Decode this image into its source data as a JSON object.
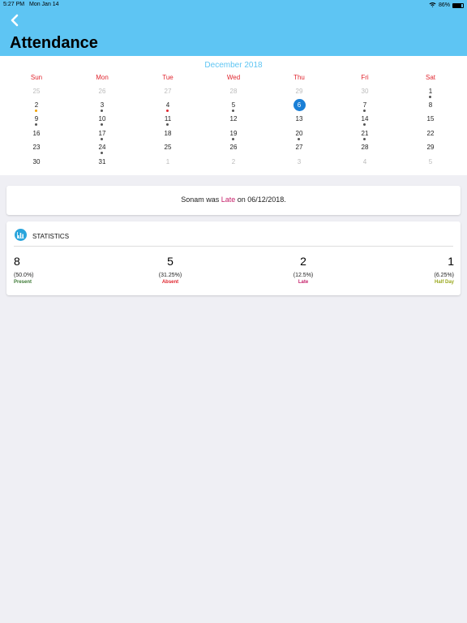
{
  "status_bar": {
    "time": "5:27 PM",
    "date": "Mon Jan 14",
    "battery": "86%",
    "battery_level": 0.86
  },
  "header": {
    "title": "Attendance"
  },
  "calendar": {
    "month": "December 2018",
    "weekdays": [
      "Sun",
      "Mon",
      "Tue",
      "Wed",
      "Thu",
      "Fri",
      "Sat"
    ],
    "weeks": [
      [
        {
          "d": "25",
          "m": true
        },
        {
          "d": "26",
          "m": true
        },
        {
          "d": "27",
          "m": true
        },
        {
          "d": "28",
          "m": true
        },
        {
          "d": "29",
          "m": true
        },
        {
          "d": "30",
          "m": true
        },
        {
          "d": "1",
          "dot": "gray"
        }
      ],
      [
        {
          "d": "2",
          "dot": "orange"
        },
        {
          "d": "3",
          "dot": "gray"
        },
        {
          "d": "4",
          "dot": "red"
        },
        {
          "d": "5",
          "dot": "gray"
        },
        {
          "d": "6",
          "selected": true
        },
        {
          "d": "7",
          "dot": "gray"
        },
        {
          "d": "8"
        }
      ],
      [
        {
          "d": "9",
          "dot": "gray"
        },
        {
          "d": "10",
          "dot": "gray"
        },
        {
          "d": "11",
          "dot": "gray"
        },
        {
          "d": "12"
        },
        {
          "d": "13"
        },
        {
          "d": "14",
          "dot": "gray"
        },
        {
          "d": "15"
        }
      ],
      [
        {
          "d": "16"
        },
        {
          "d": "17",
          "dot": "gray"
        },
        {
          "d": "18"
        },
        {
          "d": "19",
          "dot": "gray"
        },
        {
          "d": "20",
          "dot": "gray"
        },
        {
          "d": "21",
          "dot": "gray"
        },
        {
          "d": "22"
        }
      ],
      [
        {
          "d": "23"
        },
        {
          "d": "24",
          "dot": "gray"
        },
        {
          "d": "25"
        },
        {
          "d": "26"
        },
        {
          "d": "27"
        },
        {
          "d": "28"
        },
        {
          "d": "29"
        }
      ],
      [
        {
          "d": "30"
        },
        {
          "d": "31"
        },
        {
          "d": "1",
          "m": true
        },
        {
          "d": "2",
          "m": true
        },
        {
          "d": "3",
          "m": true
        },
        {
          "d": "4",
          "m": true
        },
        {
          "d": "5",
          "m": true
        }
      ]
    ],
    "dot_colors": {
      "gray": "#555555",
      "orange": "#f2a100",
      "red": "#e0262f"
    }
  },
  "summary": {
    "prefix": "Sonam was ",
    "status": "Late",
    "suffix": " on 06/12/2018."
  },
  "statistics": {
    "title": "STATISTICS",
    "items": [
      {
        "count": "8",
        "percent": "(50.0%)",
        "label": "Present",
        "color": "#3d7a35"
      },
      {
        "count": "5",
        "percent": "(31.25%)",
        "label": "Absent",
        "color": "#e0262f"
      },
      {
        "count": "2",
        "percent": "(12.5%)",
        "label": "Late",
        "color": "#c51f69"
      },
      {
        "count": "1",
        "percent": "(6.25%)",
        "label": "Half Day",
        "color": "#9aa81e"
      }
    ]
  },
  "colors": {
    "header": "#5ec5f3",
    "accent": "#1a7fd6"
  }
}
